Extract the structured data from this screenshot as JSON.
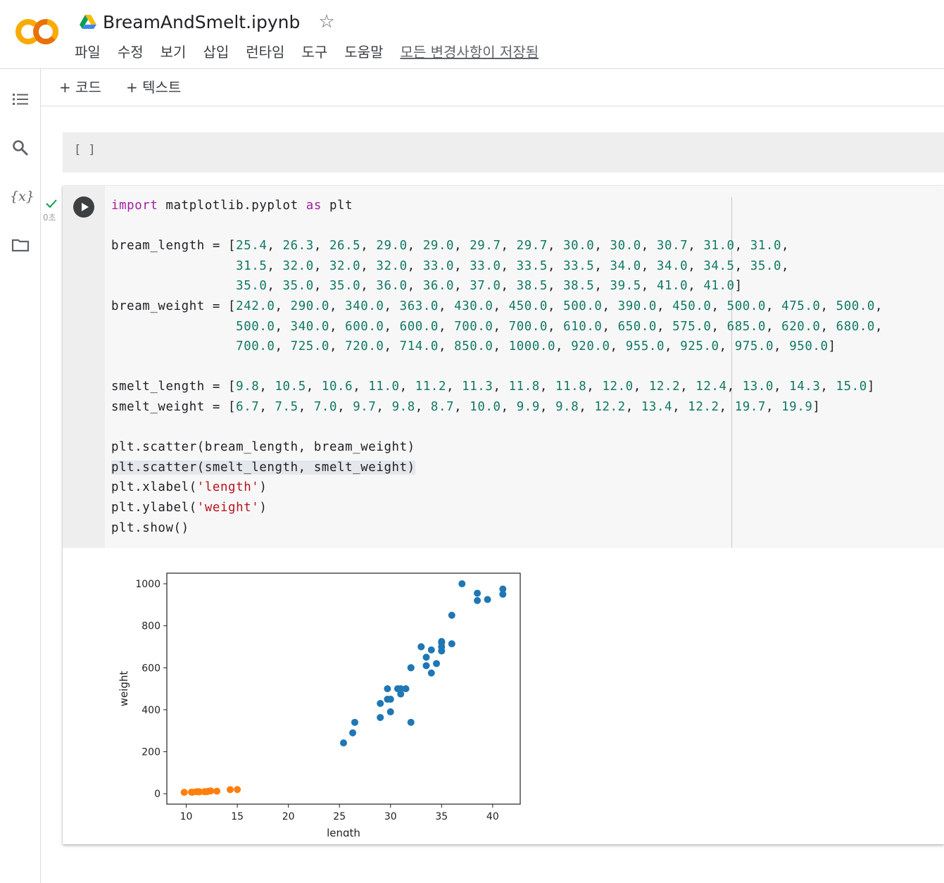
{
  "app": {
    "notebook_title": "BreamAndSmelt.ipynb",
    "menu": [
      "파일",
      "수정",
      "보기",
      "삽입",
      "런타임",
      "도구",
      "도움말"
    ],
    "saved_status": "모든 변경사항이 저장됨",
    "brand_colors": {
      "orange": "#F9AB00",
      "deep_orange": "#E8710A",
      "scatter_blue": "#1f77b4",
      "scatter_orange": "#ff7f0e"
    }
  },
  "sidebar": {
    "icons": [
      "table-of-contents-icon",
      "search-icon",
      "variables-icon",
      "folder-icon"
    ],
    "variables_glyph": "{x}"
  },
  "toolbar": {
    "add_code": "+ 코드",
    "add_text": "+ 텍스트"
  },
  "empty_cell": {
    "prompt": "[ ]"
  },
  "code_cell": {
    "exec_time": "0초",
    "lines": [
      "import matplotlib.pyplot as plt",
      "",
      "bream_length = [25.4, 26.3, 26.5, 29.0, 29.0, 29.7, 29.7, 30.0, 30.0, 30.7, 31.0, 31.0,",
      "                31.5, 32.0, 32.0, 32.0, 33.0, 33.0, 33.5, 33.5, 34.0, 34.0, 34.5, 35.0,",
      "                35.0, 35.0, 35.0, 36.0, 36.0, 37.0, 38.5, 38.5, 39.5, 41.0, 41.0]",
      "bream_weight = [242.0, 290.0, 340.0, 363.0, 430.0, 450.0, 500.0, 390.0, 450.0, 500.0, 475.0, 500.0,",
      "                500.0, 340.0, 600.0, 600.0, 700.0, 700.0, 610.0, 650.0, 575.0, 685.0, 620.0, 680.0,",
      "                700.0, 725.0, 720.0, 714.0, 850.0, 1000.0, 920.0, 955.0, 925.0, 975.0, 950.0]",
      "",
      "smelt_length = [9.8, 10.5, 10.6, 11.0, 11.2, 11.3, 11.8, 11.8, 12.0, 12.2, 12.4, 13.0, 14.3, 15.0]",
      "smelt_weight = [6.7, 7.5, 7.0, 9.7, 9.8, 8.7, 10.0, 9.9, 9.8, 12.2, 13.4, 12.2, 19.7, 19.9]",
      "",
      "plt.scatter(bream_length, bream_weight)",
      "plt.scatter(smelt_length, smelt_weight)",
      "plt.xlabel('length')",
      "plt.ylabel('weight')",
      "plt.show()"
    ]
  },
  "chart_data": {
    "type": "scatter",
    "xlabel": "length",
    "ylabel": "weight",
    "xlim": [
      8.1,
      42.7
    ],
    "ylim": [
      -49.6,
      1050.4
    ],
    "xticks": [
      10,
      15,
      20,
      25,
      30,
      35,
      40
    ],
    "yticks": [
      0,
      200,
      400,
      600,
      800,
      1000
    ],
    "grid": false,
    "series": [
      {
        "color": "#1f77b4",
        "x": [
          25.4,
          26.3,
          26.5,
          29.0,
          29.0,
          29.7,
          29.7,
          30.0,
          30.0,
          30.7,
          31.0,
          31.0,
          31.5,
          32.0,
          32.0,
          32.0,
          33.0,
          33.0,
          33.5,
          33.5,
          34.0,
          34.0,
          34.5,
          35.0,
          35.0,
          35.0,
          35.0,
          36.0,
          36.0,
          37.0,
          38.5,
          38.5,
          39.5,
          41.0,
          41.0
        ],
        "y": [
          242.0,
          290.0,
          340.0,
          363.0,
          430.0,
          450.0,
          500.0,
          390.0,
          450.0,
          500.0,
          475.0,
          500.0,
          500.0,
          340.0,
          600.0,
          600.0,
          700.0,
          700.0,
          610.0,
          650.0,
          575.0,
          685.0,
          620.0,
          680.0,
          700.0,
          725.0,
          720.0,
          714.0,
          850.0,
          1000.0,
          920.0,
          955.0,
          925.0,
          975.0,
          950.0
        ]
      },
      {
        "color": "#ff7f0e",
        "x": [
          9.8,
          10.5,
          10.6,
          11.0,
          11.2,
          11.3,
          11.8,
          11.8,
          12.0,
          12.2,
          12.4,
          13.0,
          14.3,
          15.0
        ],
        "y": [
          6.7,
          7.5,
          7.0,
          9.7,
          9.8,
          8.7,
          10.0,
          9.9,
          9.8,
          12.2,
          13.4,
          12.2,
          19.7,
          19.9
        ]
      }
    ]
  }
}
